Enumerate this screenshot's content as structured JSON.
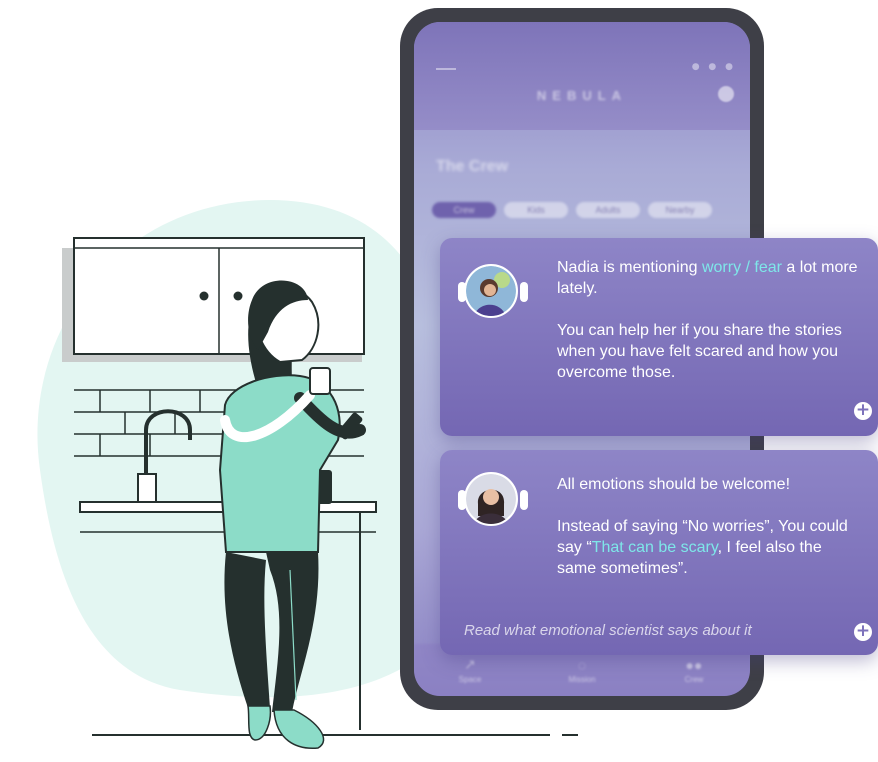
{
  "app": {
    "title": "NEBULA",
    "group_title": "The Crew",
    "chips": [
      "Crew",
      "Kids",
      "Adults",
      "Nearby"
    ],
    "nav": [
      {
        "label": "Space",
        "icon": "rocket-icon"
      },
      {
        "label": "Mission",
        "icon": "planet-icon"
      },
      {
        "label": "Crew",
        "icon": "people-icon"
      }
    ],
    "status_icons": "● ● ●"
  },
  "cards": [
    {
      "line1_pre": "Nadia is mentioning ",
      "line1_highlight": "worry / fear",
      "line1_post": " a lot more lately.",
      "line2": "You can help her if you share the stories when you have felt scared and how you overcome those."
    },
    {
      "line1": "All emotions should be welcome!",
      "line2_pre": "Instead of saying “No worries”, You could say “",
      "line2_highlight": "That can be scary",
      "line2_post": ", I feel also the same sometimes”.",
      "read_more": "Read what emotional scientist says about it"
    }
  ],
  "colors": {
    "accent": "#7467b3",
    "highlight": "#7ee7e9",
    "blob": "#e3f6f2",
    "ink": "#25302e",
    "shirt": "#8cdcc8"
  }
}
